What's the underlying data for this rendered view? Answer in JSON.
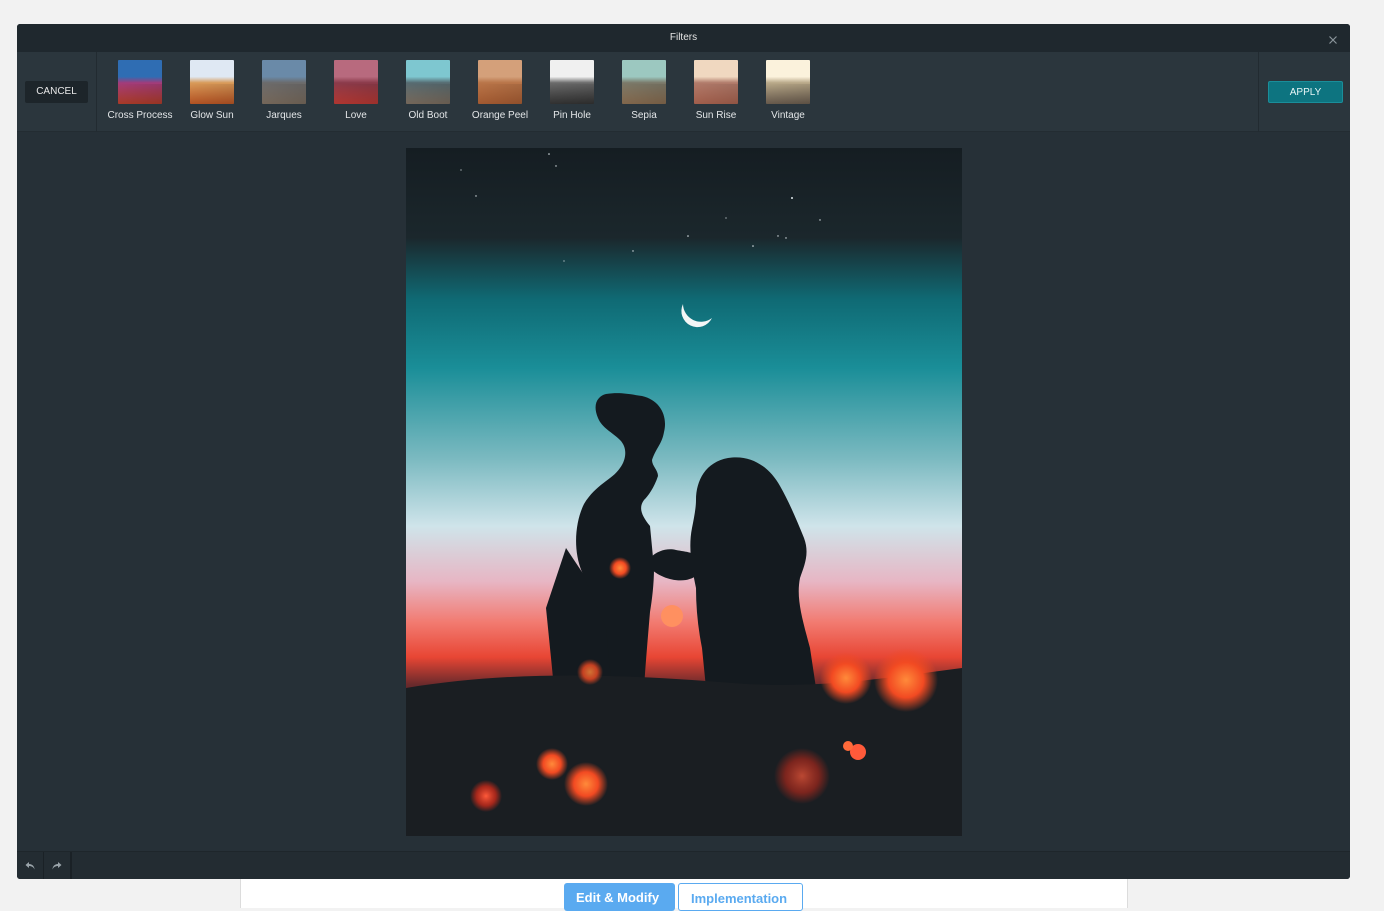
{
  "modal": {
    "title": "Filters",
    "cancel_label": "CANCEL",
    "apply_label": "APPLY"
  },
  "filters": [
    {
      "label": "Cross Process",
      "colors": [
        "#2f6db3",
        "#a23b7a",
        "#c8452f"
      ]
    },
    {
      "label": "Glow Sun",
      "colors": [
        "#dfe8f3",
        "#d89a58",
        "#d4622a"
      ]
    },
    {
      "label": "Jarques",
      "colors": [
        "#6a8aa8",
        "#6b6a6a",
        "#8a7a6a"
      ]
    },
    {
      "label": "Love",
      "colors": [
        "#b86a7e",
        "#8a3a4a",
        "#d0403a"
      ]
    },
    {
      "label": "Old Boot",
      "colors": [
        "#7ec7d0",
        "#566a70",
        "#8a7a6a"
      ]
    },
    {
      "label": "Orange Peel",
      "colors": [
        "#d4a07a",
        "#b87448",
        "#c06a3a"
      ]
    },
    {
      "label": "Pin Hole",
      "colors": [
        "#f0f0f0",
        "#6a6a6a",
        "#3a3a3a"
      ]
    },
    {
      "label": "Sepia",
      "colors": [
        "#9cc8c0",
        "#7a7868",
        "#9a7a5a"
      ]
    },
    {
      "label": "Sun Rise",
      "colors": [
        "#f0d8c0",
        "#b07a6a",
        "#c0705a"
      ]
    },
    {
      "label": "Vintage",
      "colors": [
        "#fbf2dc",
        "#b8a888",
        "#7a6a5a"
      ]
    }
  ],
  "background_page": {
    "primary_button": "Edit & Modify",
    "secondary_button": "Implementation"
  },
  "colors": {
    "modal_bg": "#263037",
    "header_bg": "#1f282e",
    "apply_bg": "#0d7480"
  }
}
